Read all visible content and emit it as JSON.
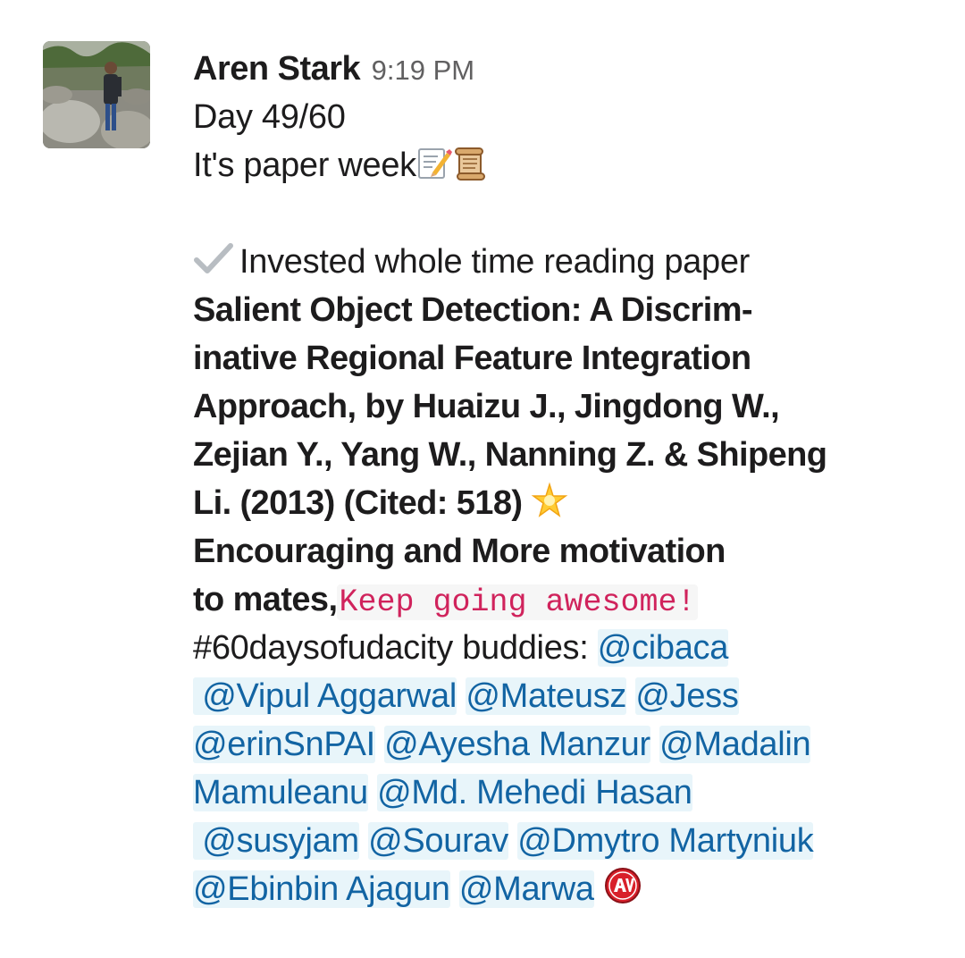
{
  "message": {
    "author": "Aren Stark",
    "timestamp": "9:19 PM",
    "avatar_icon": "profile-photo",
    "lines": {
      "day": "Day 49/60",
      "paper_week": "It's paper week",
      "invested": "Invested whole time reading paper",
      "title_1": "Salient Object Detection: A Discrim-",
      "title_2": "inative Regional Feature Integration",
      "title_3": "Approach, by Huaizu J., Jingdong W.,",
      "title_4": "Zejian Y., Yang W., Nanning Z. & Shipeng",
      "title_5": "Li. (2013) (Cited: 518)",
      "encouraging": "Encouraging and More motivation",
      "to_mates": "to mates,",
      "code_text": "Keep going awesome!",
      "hashtag": "#60daysofudacity buddies: "
    },
    "mentions": [
      "@cibaca",
      "@Vipul Aggarwal",
      "@Mateusz",
      "@Jess",
      "@erinSnPAI",
      "@Ayesha Manzur",
      "@Madalin",
      "Mamuleanu",
      "@Md. Mehedi Hasan",
      "@susyjam",
      "@Sourav",
      "@Dmytro Martyniuk",
      "@Ebinbin Ajagun",
      "@Marwa"
    ],
    "icons": [
      "memo-icon",
      "scroll-icon",
      "check-mark-icon",
      "glowing-star-icon",
      "av-badge-icon"
    ],
    "colors": {
      "mention_text": "#1264a3",
      "mention_bg": "#e8f5fa",
      "code_text": "#d0235c",
      "timestamp": "#616061"
    }
  }
}
